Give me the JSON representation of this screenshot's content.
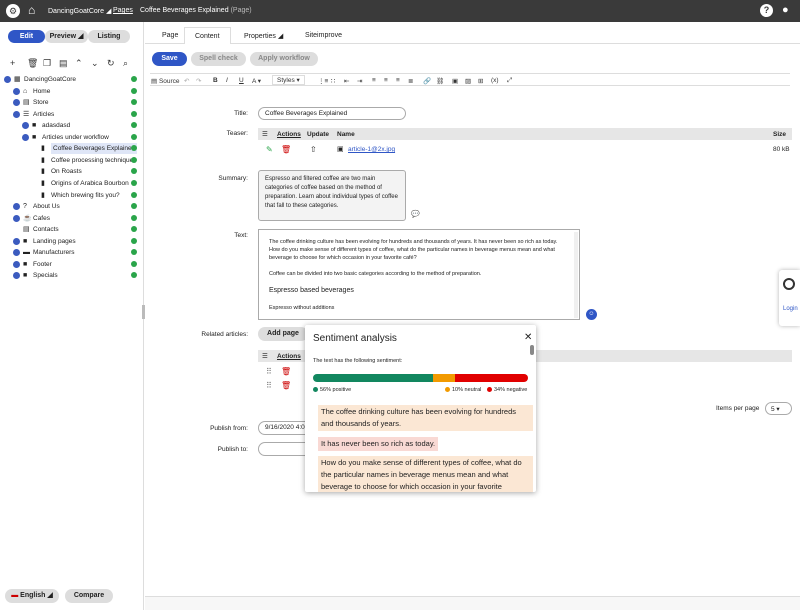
{
  "header": {
    "site": "DancingGoatCore",
    "pages": "Pages",
    "crumb": "Coffee Beverages Explained",
    "crumb_suffix": "(Page)"
  },
  "modes": {
    "edit": "Edit",
    "preview": "Preview",
    "listing": "Listing"
  },
  "tree": [
    {
      "label": "DancingGoatCore",
      "level": 0,
      "icon": "site-icon",
      "toggle": true,
      "sel": false
    },
    {
      "label": "Home",
      "level": 1,
      "icon": "home-icon",
      "toggle": true,
      "sel": false
    },
    {
      "label": "Store",
      "level": 1,
      "icon": "store-icon",
      "toggle": true,
      "sel": false
    },
    {
      "label": "Articles",
      "level": 1,
      "icon": "list-icon",
      "toggle": true,
      "sel": false
    },
    {
      "label": "adasdasd",
      "level": 2,
      "icon": "folder-icon",
      "toggle": true,
      "sel": false
    },
    {
      "label": "Articles under workflow",
      "level": 2,
      "icon": "folder-icon",
      "toggle": true,
      "sel": false
    },
    {
      "label": "Coffee Beverages Explained",
      "level": 3,
      "icon": "doc-icon",
      "toggle": false,
      "sel": true
    },
    {
      "label": "Coffee processing techniques",
      "level": 3,
      "icon": "doc-icon",
      "toggle": false,
      "sel": false
    },
    {
      "label": "On Roasts",
      "level": 3,
      "icon": "doc-icon",
      "toggle": false,
      "sel": false
    },
    {
      "label": "Origins of Arabica Bourbon",
      "level": 3,
      "icon": "doc-icon",
      "toggle": false,
      "sel": false
    },
    {
      "label": "Which brewing fits you?",
      "level": 3,
      "icon": "doc-icon",
      "toggle": false,
      "sel": false
    },
    {
      "label": "About Us",
      "level": 1,
      "icon": "question-icon",
      "toggle": true,
      "sel": false
    },
    {
      "label": "Cafes",
      "level": 1,
      "icon": "cafe-icon",
      "toggle": true,
      "sel": false
    },
    {
      "label": "Contacts",
      "level": 1,
      "icon": "contacts-icon",
      "toggle": false,
      "sel": false
    },
    {
      "label": "Landing pages",
      "level": 1,
      "icon": "folder-icon",
      "toggle": true,
      "sel": false
    },
    {
      "label": "Manufacturers",
      "level": 1,
      "icon": "factory-icon",
      "toggle": true,
      "sel": false
    },
    {
      "label": "Footer",
      "level": 1,
      "icon": "folder-icon",
      "toggle": true,
      "sel": false
    },
    {
      "label": "Specials",
      "level": 1,
      "icon": "folder-icon",
      "toggle": true,
      "sel": false
    }
  ],
  "bottom": {
    "language": "English",
    "compare": "Compare"
  },
  "tabs": [
    "Page",
    "Content",
    "Properties",
    "Siteimprove"
  ],
  "actions": {
    "save": "Save",
    "spell": "Spell check",
    "workflow": "Apply workflow"
  },
  "toolbar": {
    "source": "Source",
    "styles": "Styles"
  },
  "fields": {
    "title_label": "Title:",
    "title_value": "Coffee Beverages Explained",
    "teaser_label": "Teaser:",
    "teaser_cols": [
      "Actions",
      "Update",
      "Name",
      "Size"
    ],
    "teaser_file": "article-1@2x.jpg",
    "teaser_size": "80 kB",
    "summary_label": "Summary:",
    "summary_value": "Espresso and filtered coffee are two main categories of coffee based on the method of preparation. Learn about individual types of coffee that fall to these categories.",
    "text_label": "Text:",
    "text_p1": "The coffee drinking culture has been evolving for hundreds and thousands of years. It has never been so rich as today. How do you make sense of different types of coffee, what do the particular names in beverage menus mean and what beverage to choose for which occasion in your favorite café?",
    "text_p2": "Coffee can be divided into two basic categories according to the method of preparation.",
    "text_h": "Espresso based beverages",
    "text_p3": "Espresso without additions",
    "related_label": "Related articles:",
    "add_page": "Add page",
    "related_col": "Actions",
    "items_per_page": "Items per page",
    "items_value": "5",
    "publish_from_label": "Publish from:",
    "publish_from_value": "9/16/2020 4:0",
    "publish_to_label": "Publish to:"
  },
  "side_widget": {
    "login": "Login"
  },
  "sentiment": {
    "title": "Sentiment analysis",
    "subtitle": "The text has the following sentiment:",
    "positive": 0.56,
    "neutral": 0.1,
    "negative": 0.34,
    "positive_label": "56% positive",
    "neutral_label": "10% neutral",
    "negative_label": "34% negative",
    "colors": {
      "positive": "#12875f",
      "neutral": "#f29a00",
      "negative": "#e10000"
    },
    "sentences": [
      {
        "text": "The coffee drinking culture has been evolving for hundreds and thousands of years.",
        "tone": "neutral"
      },
      {
        "text": "It has never been so rich as today.",
        "tone": "negative"
      },
      {
        "text": "How do you make sense of different types of coffee, what do the particular names in beverage menus mean and what beverage to choose for which occasion in your favorite",
        "tone": "neutral"
      }
    ]
  }
}
